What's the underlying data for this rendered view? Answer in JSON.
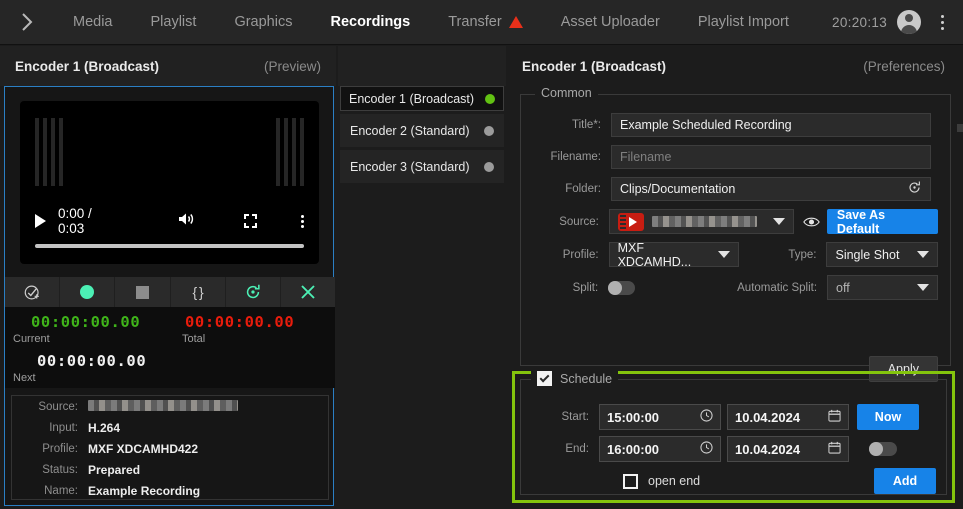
{
  "topbar": {
    "expand_icon": "chevron-right-icon",
    "tabs": [
      {
        "label": "Media",
        "active": false,
        "warn": false
      },
      {
        "label": "Playlist",
        "active": false,
        "warn": false
      },
      {
        "label": "Graphics",
        "active": false,
        "warn": false
      },
      {
        "label": "Recordings",
        "active": true,
        "warn": false
      },
      {
        "label": "Transfer",
        "active": false,
        "warn": true
      },
      {
        "label": "Asset Uploader",
        "active": false,
        "warn": false
      },
      {
        "label": "Playlist Import",
        "active": false,
        "warn": false
      }
    ],
    "clock": "20:20:13",
    "account_icon": "user-avatar-icon",
    "menu_icon": "kebab-menu-icon"
  },
  "preview": {
    "title": "Encoder 1 (Broadcast)",
    "subtitle": "(Preview)",
    "player": {
      "play_icon": "play-icon",
      "time": "0:00 / 0:03",
      "volume_icon": "volume-icon",
      "fullscreen_icon": "fullscreen-icon",
      "more_icon": "kebab-menu-icon"
    },
    "toolbar": [
      {
        "name": "prepare-recording-icon",
        "glyph": "⊕"
      },
      {
        "name": "record-icon",
        "glyph": "●"
      },
      {
        "name": "stop-icon",
        "glyph": "■"
      },
      {
        "name": "metadata-icon",
        "glyph": "{ }"
      },
      {
        "name": "reset-icon",
        "glyph": "↺"
      },
      {
        "name": "close-icon",
        "glyph": "✕"
      }
    ],
    "timecode": {
      "current_value": "00:00:00.00",
      "current_label": "Current",
      "total_value": "00:00:00.00",
      "total_label": "Total",
      "next_value": "00:00:00.00",
      "next_label": "Next",
      "current_color": "#3fb31a",
      "total_color": "#e81c0c",
      "next_color": "#f0f0f0"
    },
    "info": [
      {
        "label": "Source:",
        "value": "",
        "redacted": true
      },
      {
        "label": "Input:",
        "value": "H.264",
        "redacted": false
      },
      {
        "label": "Profile:",
        "value": "MXF XDCAMHD422",
        "redacted": false
      },
      {
        "label": "Status:",
        "value": "Prepared",
        "redacted": false
      },
      {
        "label": "Name:",
        "value": "Example Recording",
        "redacted": false
      }
    ]
  },
  "encoder_list": [
    {
      "label": "Encoder 1 (Broadcast)",
      "status": "active",
      "selected": true
    },
    {
      "label": "Encoder 2 (Standard)",
      "status": "idle",
      "selected": false
    },
    {
      "label": "Encoder 3 (Standard)",
      "status": "idle",
      "selected": false
    }
  ],
  "preferences": {
    "title": "Encoder 1 (Broadcast)",
    "subtitle": "(Preferences)",
    "common": {
      "legend": "Common",
      "title_label": "Title*:",
      "title_value": "Example Scheduled Recording",
      "filename_label": "Filename:",
      "filename_value": "",
      "filename_placeholder": "Filename",
      "folder_label": "Folder:",
      "folder_value": "Clips/Documentation",
      "folder_reset_icon": "reset-icon",
      "source_label": "Source:",
      "source_icon": "youtube-source-icon",
      "source_value": "",
      "source_redacted": true,
      "preview_eye_icon": "eye-icon",
      "save_default_label": "Save As Default",
      "profile_label": "Profile:",
      "profile_value": "MXF XDCAMHD...",
      "type_label": "Type:",
      "type_value": "Single Shot",
      "split_label": "Split:",
      "split_on": false,
      "auto_split_label": "Automatic Split:",
      "auto_split_value": "off",
      "apply_label": "Apply"
    }
  },
  "schedule": {
    "legend": "Schedule",
    "enabled": true,
    "highlight_color": "#84c40d",
    "start_label": "Start:",
    "start_time": "15:00:00",
    "start_date": "10.04.2024",
    "end_label": "End:",
    "end_time": "16:00:00",
    "end_date": "10.04.2024",
    "now_label": "Now",
    "add_label": "Add",
    "open_end_label": "open end",
    "open_end_checked": false,
    "repeat_toggle_on": false,
    "clock_icon": "clock-icon",
    "calendar_icon": "calendar-icon"
  }
}
